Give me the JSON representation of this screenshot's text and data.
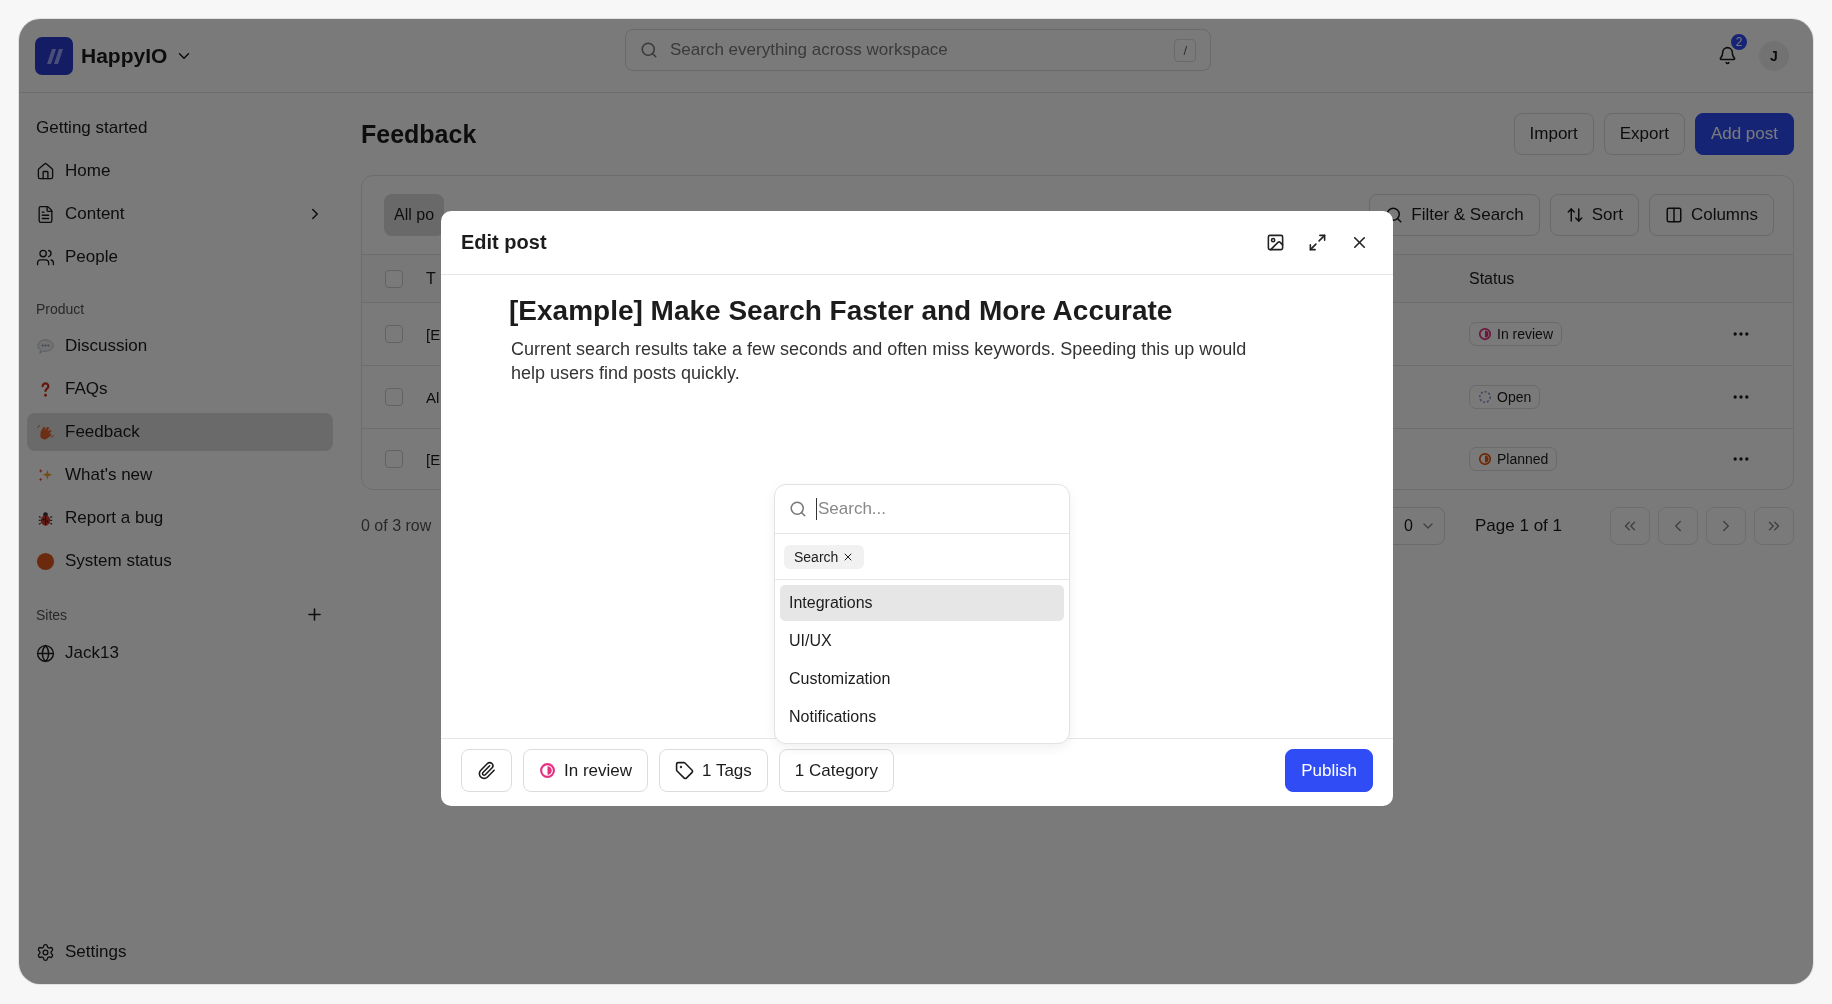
{
  "app": {
    "name": "HappyIO"
  },
  "search": {
    "placeholder": "Search everything across workspace",
    "shortcut": "/"
  },
  "notifications": {
    "count": "2"
  },
  "user": {
    "initial": "J"
  },
  "sidebar": {
    "top_items": [
      {
        "label": "Getting started",
        "kind": "plain",
        "expandable": false,
        "selected": false
      },
      {
        "label": "Home",
        "kind": "home",
        "expandable": false,
        "selected": false
      },
      {
        "label": "Content",
        "kind": "document",
        "expandable": true,
        "selected": false
      },
      {
        "label": "People",
        "kind": "people",
        "expandable": false,
        "selected": false
      }
    ],
    "groups": [
      {
        "title": "Product",
        "has_add": false,
        "items": [
          {
            "label": "Discussion",
            "kind": "chat",
            "selected": false
          },
          {
            "label": "FAQs",
            "kind": "question",
            "selected": false
          },
          {
            "label": "Feedback",
            "kind": "wave",
            "selected": true
          },
          {
            "label": "What's new",
            "kind": "sparkle",
            "selected": false
          },
          {
            "label": "Report a bug",
            "kind": "bug",
            "selected": false
          },
          {
            "label": "System status",
            "kind": "status",
            "selected": false
          }
        ]
      },
      {
        "title": "Sites",
        "has_add": true,
        "items": [
          {
            "label": "Jack13",
            "kind": "globe",
            "selected": false
          }
        ]
      }
    ],
    "footer_item": {
      "label": "Settings"
    }
  },
  "page": {
    "title": "Feedback",
    "actions": [
      {
        "label": "Import",
        "kind": "secondary"
      },
      {
        "label": "Export",
        "kind": "secondary"
      },
      {
        "label": "Add post",
        "kind": "primary"
      }
    ]
  },
  "table": {
    "tabs": [
      {
        "label": "All po",
        "selected": true
      }
    ],
    "tools": [
      {
        "label": "Filter & Search",
        "kind": "filter"
      },
      {
        "label": "Sort",
        "kind": "sort"
      },
      {
        "label": "Columns",
        "kind": "columns"
      }
    ],
    "columns": [
      "T",
      "Status"
    ],
    "header_checked": false,
    "rows": [
      {
        "title": "[E",
        "checked": false,
        "status": {
          "label": "In review",
          "kind": "in-review"
        }
      },
      {
        "title": "Al",
        "checked": false,
        "status": {
          "label": "Open",
          "kind": "open"
        }
      },
      {
        "title": "[E",
        "checked": false,
        "status": {
          "label": "Planned",
          "kind": "planned"
        }
      }
    ],
    "pagination": {
      "summary": "0 of 3 row",
      "rows_per_page": "0",
      "page": "Page 1 of 1"
    }
  },
  "modal": {
    "title": "Edit post",
    "post_title": "[Example] Make Search Faster and More Accurate",
    "body": "Current search results take a few seconds and often miss keywords. Speeding this up would help users find posts quickly.",
    "dropdown": {
      "placeholder": "Search...",
      "chips": [
        {
          "label": "Search"
        }
      ],
      "options": [
        {
          "label": "Integrations",
          "selected": true
        },
        {
          "label": "UI/UX",
          "selected": false
        },
        {
          "label": "Customization",
          "selected": false
        },
        {
          "label": "Notifications",
          "selected": false
        }
      ]
    },
    "footer": {
      "status": {
        "label": "In review",
        "kind": "in-review"
      },
      "tags": "1 Tags",
      "category": "1 Category",
      "publish": "Publish"
    }
  }
}
